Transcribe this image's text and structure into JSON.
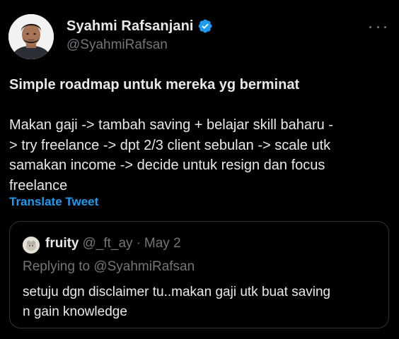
{
  "author": {
    "display_name": "Syahmi Rafsanjani",
    "handle": "@SyahmiRafsan",
    "verified_icon": "verified-badge-icon"
  },
  "tweet": {
    "title": "Simple roadmap untuk mereka yg berminat",
    "body_lines": [
      "Makan gaji -> tambah saving + belajar skill baharu -",
      "> try freelance -> dpt 2/3 client sebulan -> scale utk",
      "samakan income -> decide untuk resign dan focus",
      "freelance"
    ],
    "translate_label": "Translate Tweet"
  },
  "quoted": {
    "name": "fruity",
    "handle": "@_ft_ay",
    "separator": "·",
    "date": "May 2",
    "replying_to": "Replying to @SyahmiRafsan",
    "text_lines": [
      "setuju dgn disclaimer tu..makan gaji utk buat saving",
      "n gain knowledge"
    ]
  },
  "colors": {
    "background": "#000000",
    "text": "#e7e9ea",
    "secondary": "#71767b",
    "accent": "#1d9bf0",
    "border": "#2f3336"
  }
}
